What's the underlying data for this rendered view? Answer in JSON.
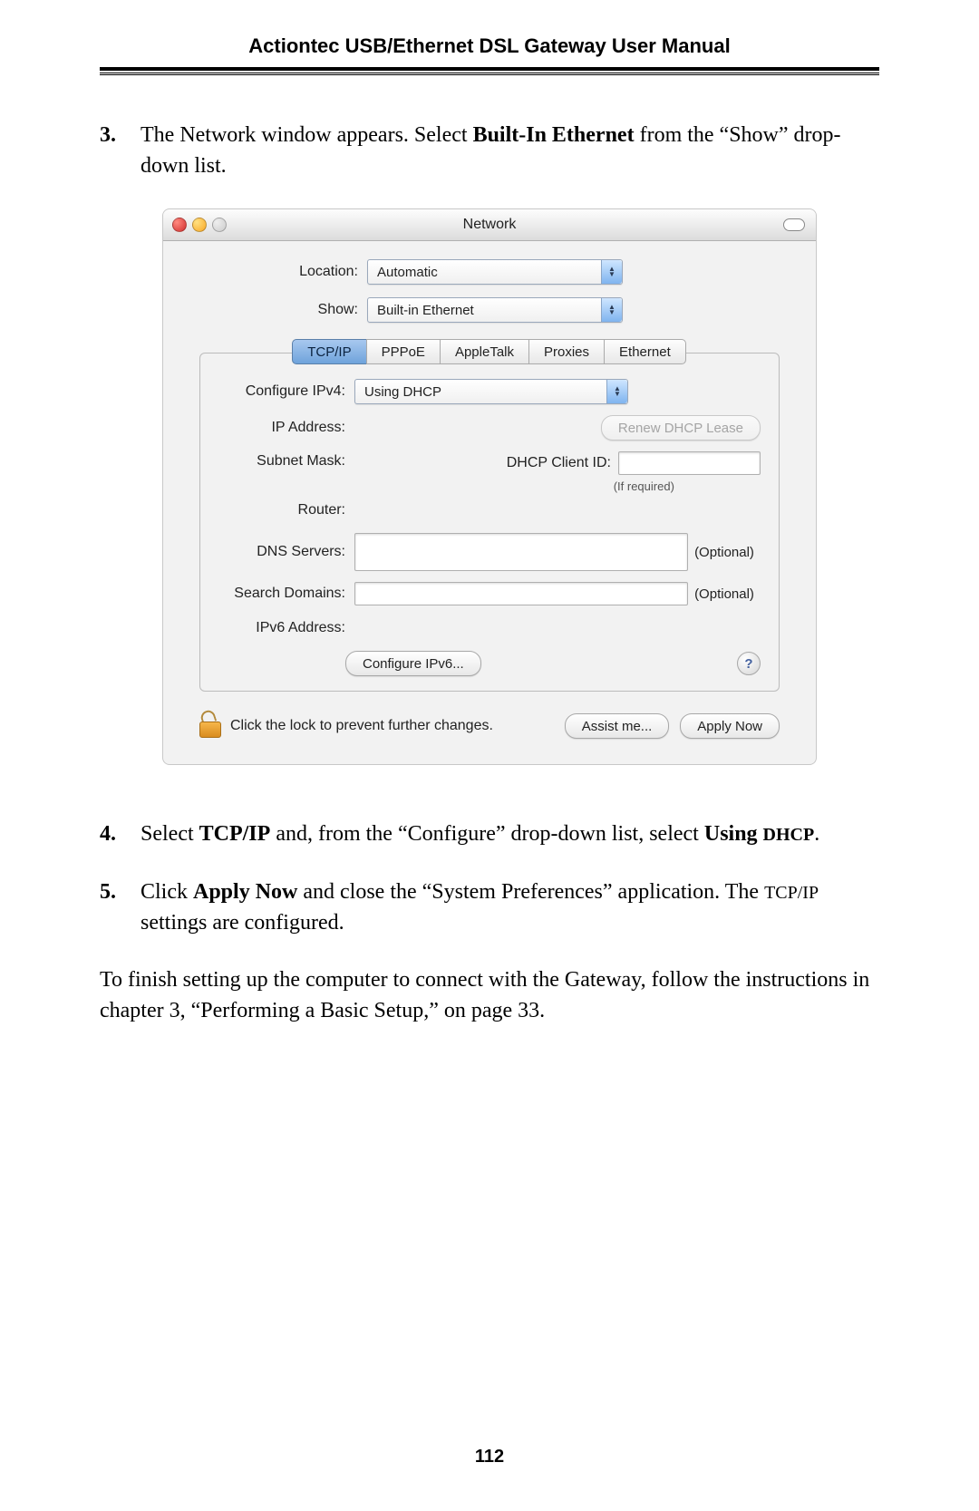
{
  "header": {
    "title": "Actiontec USB/Ethernet DSL Gateway User Manual"
  },
  "steps": {
    "s3": {
      "num": "3.",
      "pre": "The Network window appears. Select ",
      "bold": "Built-In Ethernet",
      "post": " from the “Show” drop-down list."
    },
    "s4": {
      "num": "4.",
      "t1": "Select ",
      "b1": "TCP/IP",
      "t2": " and, from the “Configure” drop-down list, select ",
      "b2": "Using ",
      "sc2": "DHCP",
      "t3": "."
    },
    "s5": {
      "num": "5.",
      "t1": "Click ",
      "b1": "Apply Now",
      "t2": " and close the “System Preferences” application. The ",
      "sc1": "TCP/IP",
      "t3": " settings are configured."
    }
  },
  "closing": "To finish setting up the computer to connect with the Gateway, follow the instructions in chapter 3, “Performing a Basic Setup,” on page 33.",
  "pageNumber": "112",
  "window": {
    "title": "Network",
    "location": {
      "label": "Location:",
      "value": "Automatic"
    },
    "show": {
      "label": "Show:",
      "value": "Built-in Ethernet"
    },
    "tabs": [
      "TCP/IP",
      "PPPoE",
      "AppleTalk",
      "Proxies",
      "Ethernet"
    ],
    "activeTab": "TCP/IP",
    "configure": {
      "label": "Configure IPv4:",
      "value": "Using DHCP"
    },
    "ipLabel": "IP Address:",
    "subnetLabel": "Subnet Mask:",
    "routerLabel": "Router:",
    "renewBtn": "Renew DHCP Lease",
    "dhcpClientLabel": "DHCP Client ID:",
    "ifRequired": "(If required)",
    "dnsLabel": "DNS Servers:",
    "searchLabel": "Search Domains:",
    "optional": "(Optional)",
    "ipv6Label": "IPv6 Address:",
    "configIpv6Btn": "Configure IPv6...",
    "helpGlyph": "?",
    "lockText": "Click the lock to prevent further changes.",
    "assistBtn": "Assist me...",
    "applyBtn": "Apply Now"
  }
}
